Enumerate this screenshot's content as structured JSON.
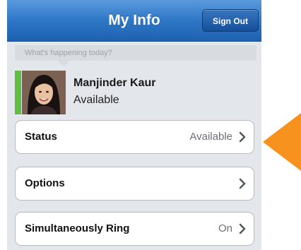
{
  "header": {
    "title": "My Info",
    "sign_out_label": "Sign Out"
  },
  "status_input": {
    "placeholder": "What's happening today?"
  },
  "user": {
    "name": "Manjinder Kaur",
    "presence": "Available",
    "presence_color": "#5fbd3f"
  },
  "menu": [
    {
      "label": "Status",
      "value": "Available"
    },
    {
      "label": "Options",
      "value": ""
    },
    {
      "label": "Simultaneously Ring",
      "value": "On"
    }
  ],
  "colors": {
    "navbar": "#2f78c7",
    "background": "#e3e6ea",
    "callout_arrow": "#f7921e"
  },
  "icons": {
    "row_chevron": "chevron-right-icon",
    "callout": "arrow-left-icon"
  }
}
